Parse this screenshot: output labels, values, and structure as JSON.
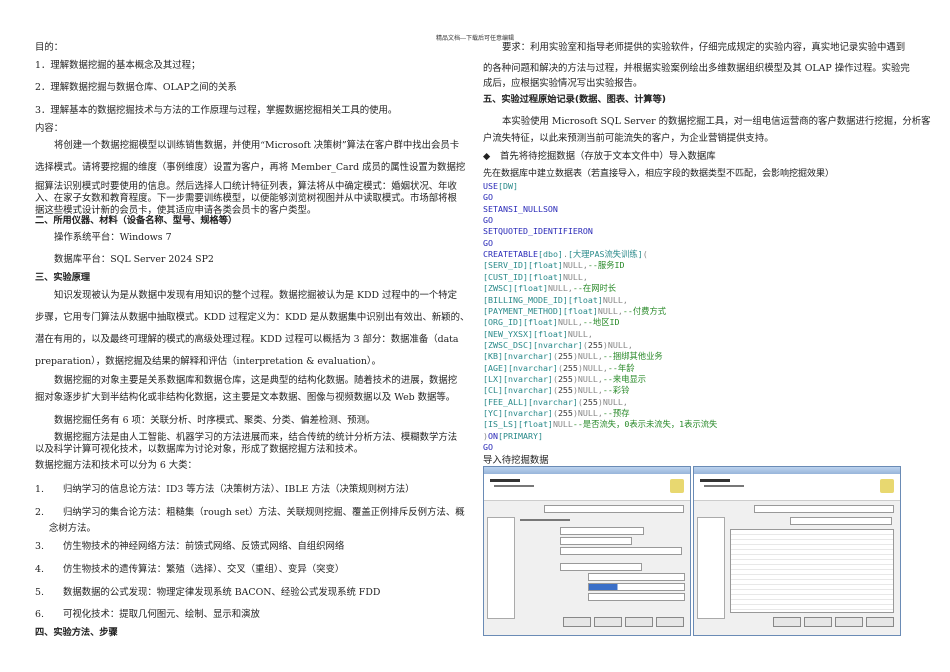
{
  "header": "精品文档---下载后可任意编辑",
  "left": {
    "purpose_label": "目的：",
    "purposes": [
      "1．理解数据挖掘的基本概念及其过程；",
      "2．理解数据挖掘与数据仓库、OLAP之间的关系",
      "3．理解基本的数据挖掘技术与方法的工作原理与过程，掌握数据挖掘相关工具的使用。"
    ],
    "content_label": "内容：",
    "content_lines": [
      "将创建一个数据挖掘模型以训练销售数据，并使用“Microsoft 决策树”算法在客户群中找出会员卡",
      "选择模式。请将要挖掘的维度（事例维度）设置为客户，再将  Member_Card 成员的属性设置为数据挖",
      "掘算法识别模式时要使用的信息。然后选择人口统计特征列表，算法将从中确定模式：婚姻状况、年收",
      "入、在家子女数和教育程度。下一步需要训练模型，以便能够浏览树视图并从中读取模式。市场部将根",
      "据这些模式设计新的会员卡，使其适应申请各类会员卡的客户类型。"
    ],
    "section2_title": "二、所用仪器、材料（设备名称、型号、规格等）",
    "os_platform": "操作系统平台：Windows 7",
    "db_platform": "数据库平台：SQL Server 2024 SP2",
    "section3_title": "三、实验原理",
    "principle_lines": [
      "知识发现被认为是从数据中发现有用知识的整个过程。数据挖掘被认为是 KDD 过程中的一个特定",
      "步骤，它用专门算法从数据中抽取模式。KDD 过程定义为：KDD 是从数据集中识别出有效出、新颖的、",
      "潜在有用的，以及最终可理解的模式的高级处理过程。KDD 过程可以概括为 3 部分：数据准备（data",
      "preparation），数据挖掘及结果的解释和评估（interpretation & evaluation）。",
      "数据挖掘的对象主要是关系数据库和数据仓库，这是典型的结构化数据。随着技术的进展，数据挖",
      "掘对象逐步扩大到半结构化或非结构化数据，这主要是文本数据、图像与视频数据以及 Web 数据等。",
      "数据挖掘任务有 6 项：关联分析、时序模式、聚类、分类、偏差检测、预测。",
      "数据挖掘方法是由人工智能、机器学习的方法进展而来，结合传统的统计分析方法、模糊数学方法",
      "以及科学计算可视化技术，以数据库为讨论对象，形成了数据挖掘方法和技术。",
      "数据挖掘方法和技术可以分为 6 大类："
    ],
    "methods": [
      {
        "num": "1.",
        "text": "归纳学习的信息论方法：ID3 等方法（决策树方法）、IBLE 方法（决策规则树方法）"
      },
      {
        "num": "2.",
        "text": "归纳学习的集合论方法：粗糙集（rough set）方法、关联规则挖掘、覆盖正例排斥反例方法、概",
        "cont": "念树方法。"
      },
      {
        "num": "3.",
        "text": "仿生物技术的神经网络方法：前馈式网络、反馈式网络、自组织网络"
      },
      {
        "num": "4.",
        "text": "仿生物技术的遗传算法：繁殖（选择）、交叉（重组）、变异（突变）"
      },
      {
        "num": "5.",
        "text": "数据数据的公式发现：物理定律发现系统 BACON、经验公式发现系统 FDD"
      },
      {
        "num": "6.",
        "text": "可视化技术：提取几何图元、绘制、显示和演放"
      }
    ],
    "section4_title": "四、实验方法、步骤"
  },
  "right": {
    "requirement_lines": [
      "要求：利用实验室和指导老师提供的实验软件，仔细完成规定的实验内容，真实地记录实验中遇到",
      "的各种问题和解决的方法与过程，并根据实验案例绘出多维数据组织模型及其 OLAP 操作过程。实验完",
      "成后，应根据实验情况写出实验报告。"
    ],
    "section5_title": "五、实验过程原始记录(数据、图表、计算等)",
    "intro_lines": [
      "本实验使用 Microsoft SQL Server 的数据挖掘工具，对一组电信运营商的客户数据进行挖掘，分析客",
      "户流失特征，以此来预测当前可能流失的客户，为企业营销提供支持。"
    ],
    "bullet": "◆",
    "bullet_text": "首先将待挖掘数据（存放于文本文件中）导入数据库",
    "create_note": "先在数据库中建立数据表（若直接导入，相应字段的数据类型不匹配，会影响挖掘效果）",
    "code": [
      [
        [
          "kw",
          "USE"
        ],
        [
          "br",
          "[DW]"
        ]
      ],
      [
        [
          "kw",
          "GO"
        ]
      ],
      [
        [
          "kw",
          "SETANSI_NULLSON"
        ]
      ],
      [
        [
          "kw",
          "GO"
        ]
      ],
      [
        [
          "kw",
          "SETQUOTED_IDENTIFIERON"
        ]
      ],
      [
        [
          "kw",
          "GO"
        ]
      ],
      [
        [
          "kw",
          "CREATETABLE"
        ],
        [
          "br",
          "[dbo]"
        ],
        [
          "nl",
          "."
        ],
        [
          "br",
          "[大理PAS流失训练]"
        ],
        [
          "nl",
          "("
        ]
      ],
      [
        [
          "br",
          "[SERV_ID][float]"
        ],
        [
          "nl",
          "NULL,"
        ],
        [
          "cm",
          "--服务ID"
        ]
      ],
      [
        [
          "br",
          "[CUST_ID][float]"
        ],
        [
          "nl",
          "NULL,"
        ]
      ],
      [
        [
          "br",
          "[ZWSC][float]"
        ],
        [
          "nl",
          "NULL,"
        ],
        [
          "cm",
          "--在网时长"
        ]
      ],
      [
        [
          "br",
          "[BILLING_MODE_ID][float]"
        ],
        [
          "nl",
          "NULL,"
        ]
      ],
      [
        [
          "br",
          "[PAYMENT_METHOD][float]"
        ],
        [
          "nl",
          "NULL,"
        ],
        [
          "cm",
          "--付费方式"
        ]
      ],
      [
        [
          "br",
          "[ORG_ID][float]"
        ],
        [
          "nl",
          "NULL,"
        ],
        [
          "cm",
          "--地区ID"
        ]
      ],
      [
        [
          "br",
          "[NEW_YXSX][float]"
        ],
        [
          "nl",
          "NULL,"
        ]
      ],
      [
        [
          "br",
          "[ZWSC_DSC][nvarchar]"
        ],
        [
          "nl",
          "("
        ],
        [
          "pl",
          "255"
        ],
        [
          "nl",
          ")NULL,"
        ]
      ],
      [
        [
          "br",
          "[KB][nvarchar]"
        ],
        [
          "nl",
          "("
        ],
        [
          "pl",
          "255"
        ],
        [
          "nl",
          ")NULL,"
        ],
        [
          "cm",
          "--捆绑其他业务"
        ]
      ],
      [
        [
          "br",
          "[AGE][nvarchar]"
        ],
        [
          "nl",
          "("
        ],
        [
          "pl",
          "255"
        ],
        [
          "nl",
          ")NULL,"
        ],
        [
          "cm",
          "--年龄"
        ]
      ],
      [
        [
          "br",
          "[LX][nvarchar]"
        ],
        [
          "nl",
          "("
        ],
        [
          "pl",
          "255"
        ],
        [
          "nl",
          ")NULL,"
        ],
        [
          "cm",
          "--来电显示"
        ]
      ],
      [
        [
          "br",
          "[CL][nvarchar]"
        ],
        [
          "nl",
          "("
        ],
        [
          "pl",
          "255"
        ],
        [
          "nl",
          ")NULL,"
        ],
        [
          "cm",
          "--彩铃"
        ]
      ],
      [
        [
          "br",
          "[FEE_ALL][nvarchar]"
        ],
        [
          "nl",
          "("
        ],
        [
          "pl",
          "255"
        ],
        [
          "nl",
          ")NULL,"
        ]
      ],
      [
        [
          "br",
          "[YC][nvarchar]"
        ],
        [
          "nl",
          "("
        ],
        [
          "pl",
          "255"
        ],
        [
          "nl",
          ")NULL,"
        ],
        [
          "cm",
          "--预存"
        ]
      ],
      [
        [
          "br",
          "[IS_LS][float]"
        ],
        [
          "nl",
          "NULL"
        ],
        [
          "cm",
          "--是否流失，0表示未流失，1表示流失"
        ]
      ],
      [
        [
          "nl",
          ")"
        ],
        [
          "kw",
          "ON"
        ],
        [
          "br",
          "[PRIMARY]"
        ]
      ],
      [
        [
          "kw",
          "GO"
        ]
      ]
    ],
    "import_label": "导入待挖掘数据"
  }
}
